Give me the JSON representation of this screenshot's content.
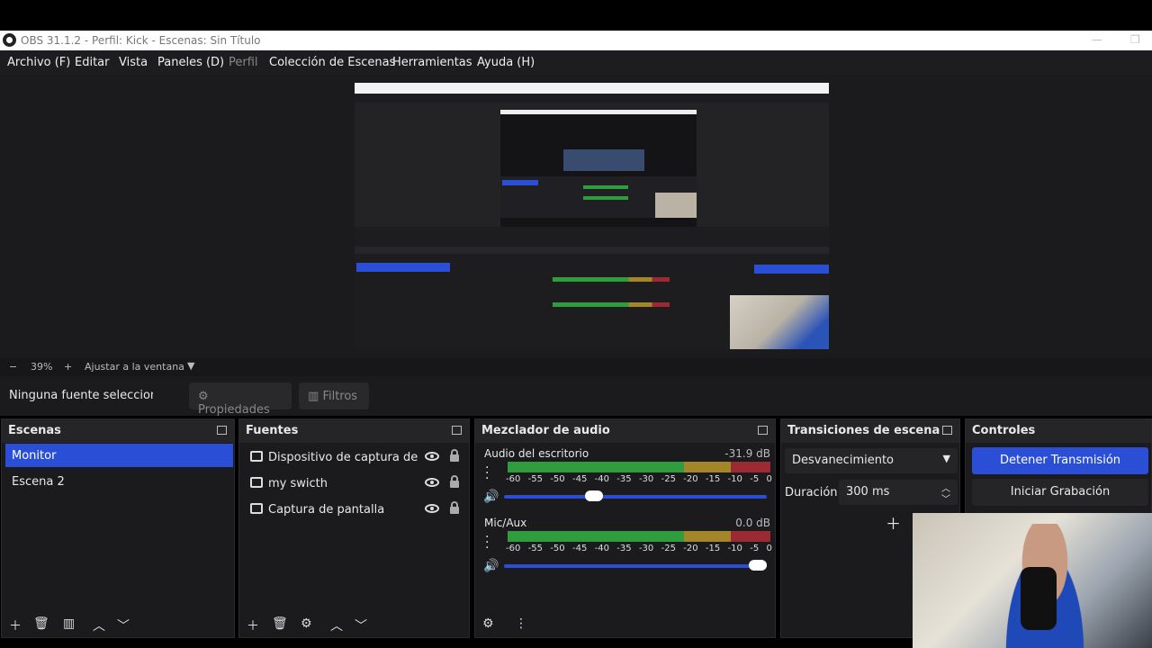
{
  "window": {
    "title": "OBS 31.1.2 - Perfil: Kick - Escenas: Sin Título"
  },
  "menu": {
    "items": [
      "Archivo (F)",
      "Editar",
      "Vista",
      "Paneles (D)",
      "Perfil",
      "Colección de Escenas",
      "Herramientas",
      "Ayuda (H)"
    ]
  },
  "zoom": {
    "minus": "−",
    "value": "39%",
    "plus": "+",
    "fit": "Ajustar a la ventana"
  },
  "source_bar": {
    "status": "Ninguna fuente seleccionada",
    "properties": "Propiedades",
    "filters": "Filtros"
  },
  "scenes": {
    "title": "Escenas",
    "items": [
      "Monitor",
      "Escena 2"
    ],
    "selected": "Monitor"
  },
  "sources": {
    "title": "Fuentes",
    "items": [
      {
        "label": "Dispositivo de captura de video",
        "icon": "camera-icon"
      },
      {
        "label": "my swicth",
        "icon": "camera-icon"
      },
      {
        "label": "Captura de pantalla",
        "icon": "monitor-icon"
      }
    ]
  },
  "mixer": {
    "title": "Mezclador de audio",
    "channels": [
      {
        "name": "Audio del escritorio",
        "db": "-31.9 dB",
        "volume": 0.33
      },
      {
        "name": "Mic/Aux",
        "db": "0.0 dB",
        "volume": 1.0
      }
    ],
    "scale": [
      "-60",
      "-55",
      "-50",
      "-45",
      "-40",
      "-35",
      "-30",
      "-25",
      "-20",
      "-15",
      "-10",
      "-5",
      "0"
    ]
  },
  "transitions": {
    "title": "Transiciones de escena",
    "selected": "Desvanecimiento",
    "duration_label": "Duración",
    "duration_value": "300 ms"
  },
  "controls": {
    "title": "Controles",
    "stop_stream": "Detener Transmisión",
    "start_recording": "Iniciar Grabación"
  },
  "colors": {
    "accent": "#2a4fd6",
    "panel": "#1b1b1d"
  }
}
